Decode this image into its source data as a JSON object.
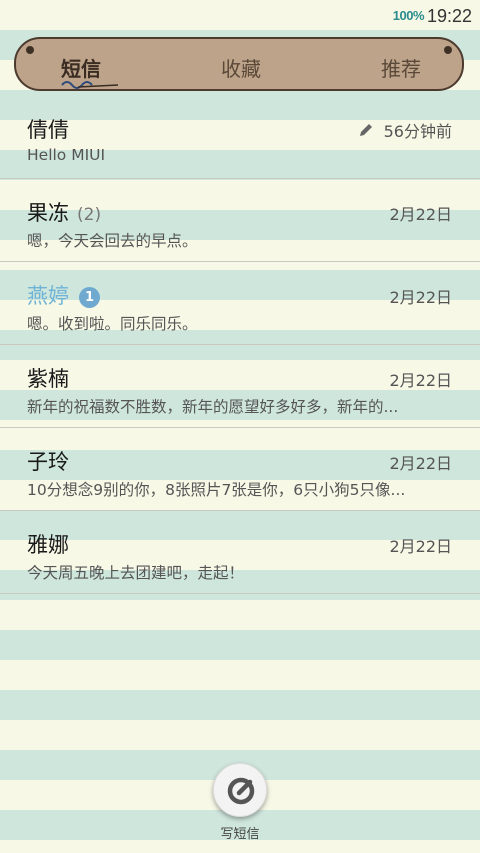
{
  "status": {
    "battery": "100%",
    "time": "19:22"
  },
  "tabs": {
    "sms": "短信",
    "favorites": "收藏",
    "recommend": "推荐"
  },
  "conversations": [
    {
      "name": "倩倩",
      "count": "",
      "unread": "",
      "date": "56分钟前",
      "preview": "Hello MIUI"
    },
    {
      "name": "果冻",
      "count": "(2)",
      "unread": "",
      "date": "2月22日",
      "preview": "嗯，今天会回去的早点。"
    },
    {
      "name": "燕婷",
      "count": "",
      "unread": "1",
      "date": "2月22日",
      "preview": "嗯。收到啦。同乐同乐。"
    },
    {
      "name": "紫楠",
      "count": "",
      "unread": "",
      "date": "2月22日",
      "preview": "新年的祝福数不胜数，新年的愿望好多好多，新年的..."
    },
    {
      "name": "子玲",
      "count": "",
      "unread": "",
      "date": "2月22日",
      "preview": "10分想念9别的你，8张照片7张是你，6只小狗5只像..."
    },
    {
      "name": "雅娜",
      "count": "",
      "unread": "",
      "date": "2月22日",
      "preview": "今天周五晚上去团建吧，走起！"
    }
  ],
  "compose": {
    "label": "写短信"
  }
}
